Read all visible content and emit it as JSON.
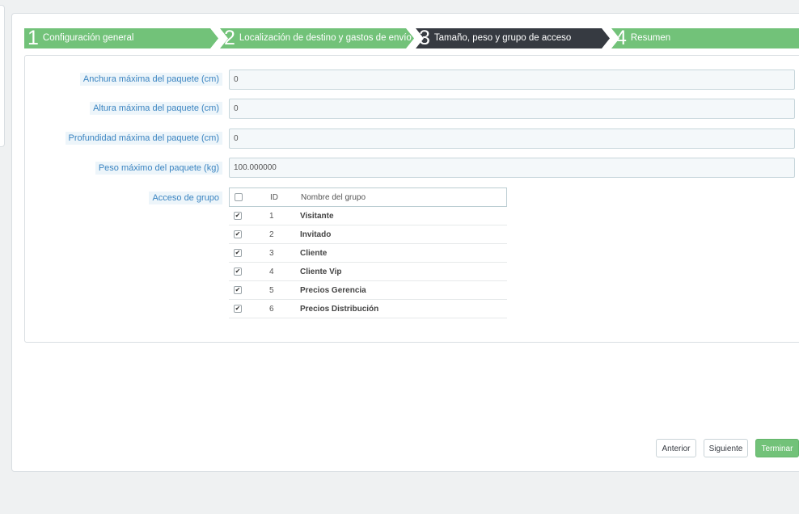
{
  "wizard": {
    "steps": [
      {
        "number": "1",
        "label": "Configuración general"
      },
      {
        "number": "2",
        "label": "Localización de destino y gastos de envío"
      },
      {
        "number": "3",
        "label": "Tamaño, peso y grupo de acceso"
      },
      {
        "number": "4",
        "label": "Resumen"
      }
    ],
    "active_step": 3,
    "colors": {
      "done": "#72c279",
      "active": "#363a41"
    }
  },
  "form": {
    "max_width": {
      "label": "Anchura máxima del paquete (cm)",
      "value": "0"
    },
    "max_height": {
      "label": "Altura máxima del paquete (cm)",
      "value": "0"
    },
    "max_depth": {
      "label": "Profundidad máxima del paquete (cm)",
      "value": "0"
    },
    "max_weight": {
      "label": "Peso máximo del paquete (kg)",
      "value": "100.000000"
    },
    "group_access": {
      "label": "Acceso de grupo",
      "header": {
        "id": "ID",
        "name": "Nombre del grupo"
      },
      "header_checked": false,
      "groups": [
        {
          "id": "1",
          "name": "Visitante",
          "checked": true
        },
        {
          "id": "2",
          "name": "Invitado",
          "checked": true
        },
        {
          "id": "3",
          "name": "Cliente",
          "checked": true
        },
        {
          "id": "4",
          "name": "Cliente Vip",
          "checked": true
        },
        {
          "id": "5",
          "name": "Precios Gerencia",
          "checked": true
        },
        {
          "id": "6",
          "name": "Precios Distribución",
          "checked": true
        }
      ]
    }
  },
  "buttons": {
    "previous": "Anterior",
    "next": "Siguiente",
    "finish": "Terminar"
  }
}
